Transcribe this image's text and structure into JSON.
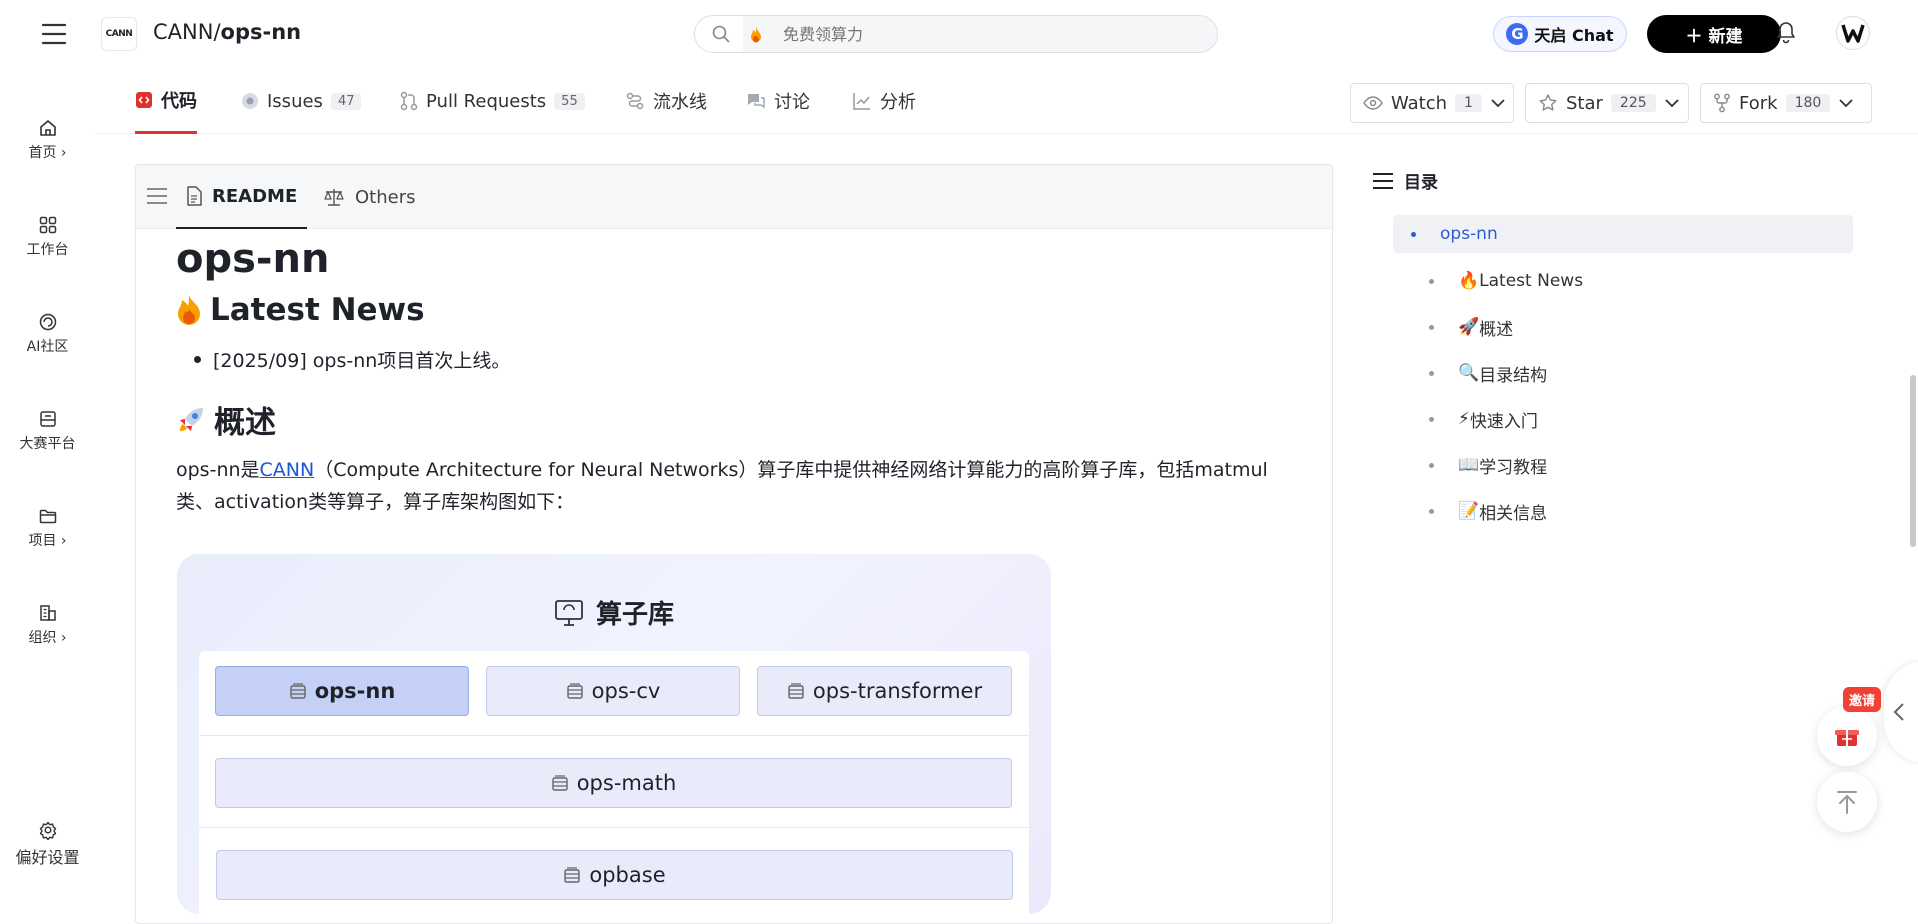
{
  "topbar": {
    "logo_text": "CANN",
    "repo_owner": "CANN/",
    "repo_name": "ops-nn",
    "search_placeholder": "免费领算力",
    "tianqi_label": "天启 Chat",
    "new_label": "新建"
  },
  "sidebar": {
    "items": [
      {
        "label": "首页 ›"
      },
      {
        "label": "工作台"
      },
      {
        "label": "AI社区"
      },
      {
        "label": "大赛平台"
      },
      {
        "label": "项目 ›"
      },
      {
        "label": "组织 ›"
      }
    ],
    "settings_label": "偏好设置"
  },
  "repo_nav": {
    "tabs": [
      {
        "label": "代码",
        "count": ""
      },
      {
        "label": "Issues",
        "count": "47"
      },
      {
        "label": "Pull Requests",
        "count": "55"
      },
      {
        "label": "流水线",
        "count": ""
      },
      {
        "label": "讨论",
        "count": ""
      },
      {
        "label": "分析",
        "count": ""
      }
    ],
    "watch": {
      "label": "Watch",
      "count": "1"
    },
    "star": {
      "label": "Star",
      "count": "225"
    },
    "fork": {
      "label": "Fork",
      "count": "180"
    }
  },
  "readme": {
    "tabs": [
      "README",
      "Others"
    ],
    "title": "ops-nn",
    "news_heading": "Latest News",
    "news_items": [
      "[2025/09] ops-nn项目首次上线。"
    ],
    "overview_heading": "概述",
    "overview_prefix": "ops-nn是",
    "overview_link": "CANN",
    "overview_rest": "（Compute Architecture for Neural Networks）算子库中提供神经网络计算能力的高阶算子库，包括matmul",
    "overview_line2": "类、activation类等算子，算子库架构图如下：",
    "arch": {
      "title": "算子库",
      "row1": [
        "ops-nn",
        "ops-cv",
        "ops-transformer"
      ],
      "row2": "ops-math",
      "row3": "opbase"
    }
  },
  "toc": {
    "title": "目录",
    "items": [
      {
        "label": "ops-nn",
        "emoji": ""
      },
      {
        "label": "Latest News",
        "emoji": "🔥"
      },
      {
        "label": "概述",
        "emoji": "🚀"
      },
      {
        "label": "目录结构",
        "emoji": "🔍"
      },
      {
        "label": "快速入门",
        "emoji": "⚡"
      },
      {
        "label": "学习教程",
        "emoji": "📖"
      },
      {
        "label": "相关信息",
        "emoji": "📝"
      }
    ]
  },
  "floating": {
    "invite_label": "邀请"
  }
}
